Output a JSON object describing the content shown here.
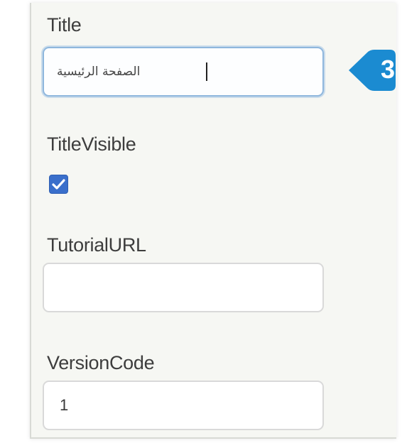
{
  "properties": {
    "title": {
      "label": "Title",
      "value": "الصفحة الرئيسية"
    },
    "title_visible": {
      "label": "TitleVisible",
      "checked": true
    },
    "tutorial_url": {
      "label": "TutorialURL",
      "value": ""
    },
    "version_code": {
      "label": "VersionCode",
      "value": "1"
    }
  },
  "callout": {
    "number": "3",
    "color": "#1b8bd1"
  },
  "colors": {
    "checkbox": "#3a6fcb",
    "focus_border": "#8fb7dd"
  }
}
